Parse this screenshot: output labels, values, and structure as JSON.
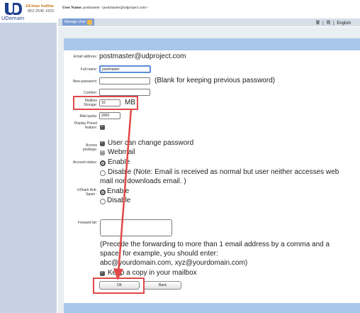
{
  "brand": {
    "logo_text": "UDomain",
    "hotline_title": "24-hour hotline",
    "hotline_number": "852-2540 1503"
  },
  "header": {
    "user_label": "User Name:",
    "user_value": "postmaster <postmaster@udproject.com>",
    "tab_manage": "Manage User",
    "lang_trad": "繁",
    "lang_simp": "简",
    "lang_sep": "|",
    "lang_english": "English"
  },
  "form": {
    "email_label": "Email address:",
    "email_value": "postmaster@udproject.com",
    "fullname_label": "Full name:",
    "fullname_value": "postmaster",
    "newpw_label": "New password:",
    "newpw_hint": "(Blank for keeping previous password)",
    "confirm_label": "Confirm:",
    "mailbox_label_1": "Mailbox",
    "mailbox_label_2": "Storage:",
    "mailbox_value": "10",
    "mailbox_unit": "MB",
    "quota_label": "Mail quota:",
    "quota_value": "2000",
    "preset_label_1": "Display Preset",
    "preset_label_2": "feature:",
    "access_label_1": "Access",
    "access_label_2": "privilege:",
    "access_opt1": "User can change password",
    "access_opt2": "Webmail",
    "status_label": "Account status:",
    "status_enable": "Enable",
    "status_disable_1": "Disable (Note: Email is received as normal but user neither accesses web",
    "status_disable_2": "mail nor downloads email. )",
    "spam_label_1": "UShark Anti-",
    "spam_label_2": "Spam :",
    "spam_enable": "Enable",
    "spam_disable": "Disable",
    "forward_label": "Forward list:",
    "forward_note_1": "(Precede the forwarding to more than 1 email address by a comma and a",
    "forward_note_2": "space, for example, you should enter:",
    "forward_note_3": "abc@yourdomain.com, xyz@yourdomain.com)",
    "keep_copy": "Keep a copy in your mailbox",
    "ok_label": "OK",
    "back_label": "Back"
  },
  "colors": {
    "accent": "#a8c7ea",
    "sidebar": "#c6d2e4",
    "highlight": "#e04848",
    "tab": "#7a9cd4"
  }
}
